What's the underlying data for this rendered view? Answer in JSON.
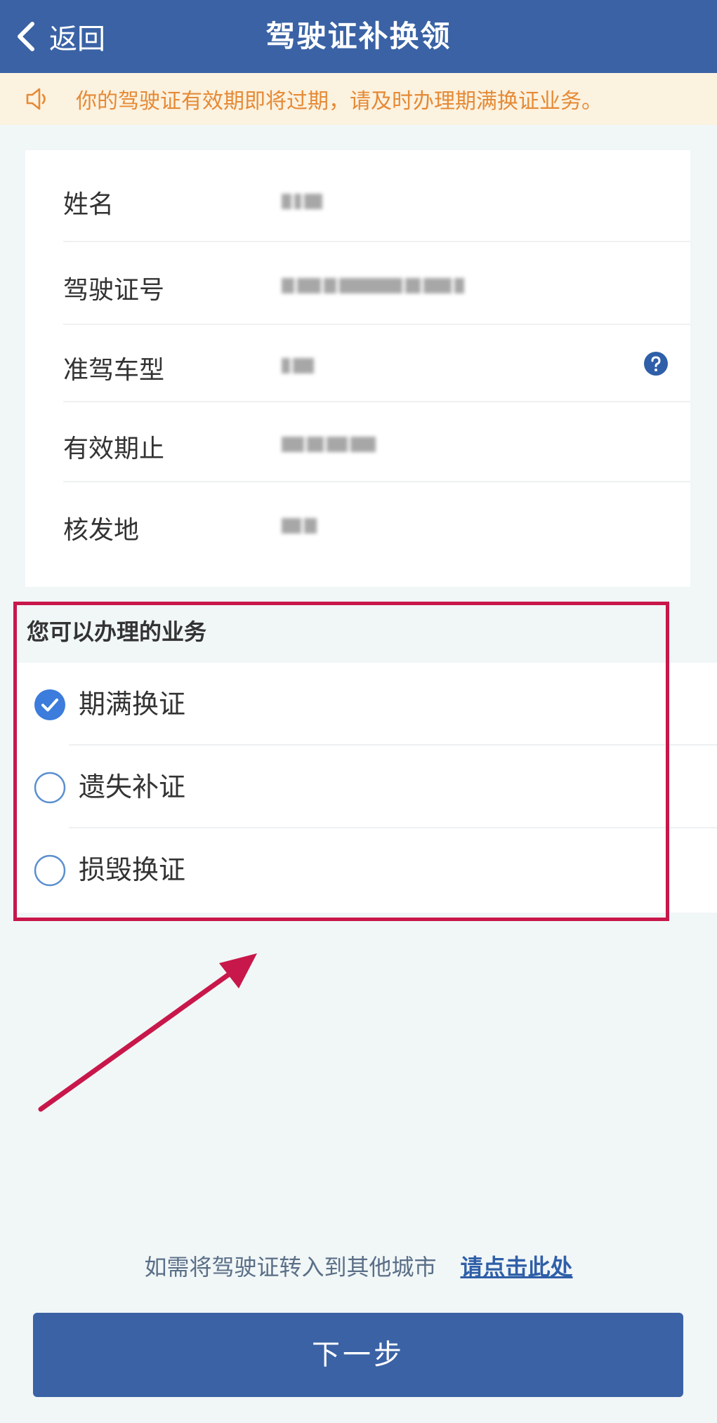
{
  "header": {
    "back_label": "返回",
    "title": "驾驶证补换领"
  },
  "notice": {
    "icon": "speaker-icon",
    "text": "你的驾驶证有效期即将过期，请及时办理期满换证业务。"
  },
  "license_info": {
    "rows": [
      {
        "label": "姓名",
        "value": ""
      },
      {
        "label": "驾驶证号",
        "value": ""
      },
      {
        "label": "准驾车型",
        "value": ""
      },
      {
        "label": "有效期止",
        "value": ""
      },
      {
        "label": "核发地",
        "value": ""
      }
    ]
  },
  "services": {
    "title": "您可以办理的业务",
    "options": [
      {
        "label": "期满换证",
        "checked": true
      },
      {
        "label": "遗失补证",
        "checked": false
      },
      {
        "label": "损毁换证",
        "checked": false
      }
    ]
  },
  "transfer": {
    "text": "如需将驾驶证转入到其他城市",
    "link": "请点击此处"
  },
  "footer": {
    "next_label": "下一步"
  },
  "colors": {
    "primary": "#3a62a5",
    "notice_bg": "#fcf2e0",
    "notice_text": "#e58a35",
    "annotation": "#c8174a",
    "page_bg": "#f1f6f7"
  }
}
